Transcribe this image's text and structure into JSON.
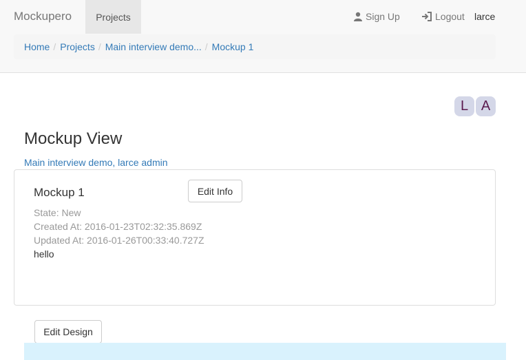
{
  "navbar": {
    "brand": "Mockupero",
    "active_tab": "Projects",
    "signup_label": "Sign Up",
    "signup_icon": "user-icon",
    "logout_label": "Logout",
    "logout_icon": "logout-icon",
    "username": "larce"
  },
  "breadcrumb": {
    "items": [
      "Home",
      "Projects",
      "Main interview demo..."
    ],
    "separator": "/",
    "active": "Mockup 1"
  },
  "avatars": [
    "L",
    "A"
  ],
  "page": {
    "title": "Mockup View",
    "subtitle": "Main interview demo, larce admin"
  },
  "mockup": {
    "name": "Mockup 1",
    "edit_info_label": "Edit Info",
    "state": "State: New",
    "created_at": "Created At: 2016-01-23T02:32:35.869Z",
    "updated_at": "Updated At: 2016-01-26T00:33:40.727Z",
    "description": "hello"
  },
  "design": {
    "edit_design_label": "Edit Design"
  },
  "colors": {
    "link": "#337ab7",
    "navbar_bg": "#f8f8f8",
    "breadcrumb_bg": "#f5f5f5",
    "avatar_bg": "#d4d7e8",
    "avatar_text": "#5a1a4e",
    "design_area_bg": "#d9f2fd"
  }
}
